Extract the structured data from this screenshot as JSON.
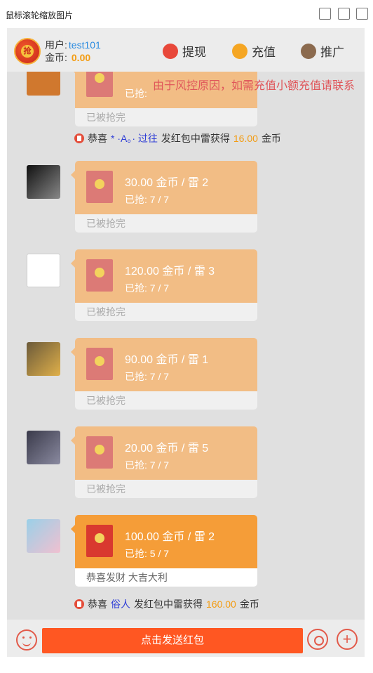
{
  "viewer": {
    "title": "鼠标滚轮缩放图片"
  },
  "header": {
    "logo_text": "抢",
    "user_label": "用户:",
    "user_value": "test101",
    "coin_label": "金币:",
    "coin_value": "0.00",
    "nav": [
      {
        "label": "提现",
        "icon": "withdraw-icon"
      },
      {
        "label": "充值",
        "icon": "recharge-icon"
      },
      {
        "label": "推广",
        "icon": "promote-icon"
      }
    ]
  },
  "marquee_text": "由于风控原因，如需充值小额充值请联系",
  "messages": [
    {
      "amount": "",
      "grabbed": "已抢:",
      "footer": "已被抢完",
      "active": false
    },
    {
      "amount": "30.00 金币 / 雷 2",
      "grabbed": "已抢:  7 / 7",
      "footer": "已被抢完",
      "active": false
    },
    {
      "amount": "120.00 金币 / 雷 3",
      "grabbed": "已抢:  7 / 7",
      "footer": "已被抢完",
      "active": false
    },
    {
      "amount": "90.00 金币 / 雷 1",
      "grabbed": "已抢:  7 / 7",
      "footer": "已被抢完",
      "active": false
    },
    {
      "amount": "20.00 金币 / 雷 5",
      "grabbed": "已抢:  7 / 7",
      "footer": "已被抢完",
      "active": false
    },
    {
      "amount": "100.00 金币 / 雷 2",
      "grabbed": "已抢:  5 / 7",
      "footer": "恭喜发财 大吉大利",
      "active": true
    }
  ],
  "notices": [
    {
      "prefix": "恭喜",
      "name": "* ·A。· 过往",
      "middle": "发红包中雷获得",
      "amount": "16.00",
      "suffix": "金币"
    },
    {
      "prefix": "恭喜",
      "name": "俗人",
      "middle": "发红包中雷获得",
      "amount": "160.00",
      "suffix": "金币"
    }
  ],
  "footer": {
    "send_label": "点击发送红包"
  },
  "colors": {
    "accent": "#ff5722",
    "packet_done": "#f2bd85",
    "packet_active": "#f59d38",
    "link": "#2f3ed6"
  }
}
